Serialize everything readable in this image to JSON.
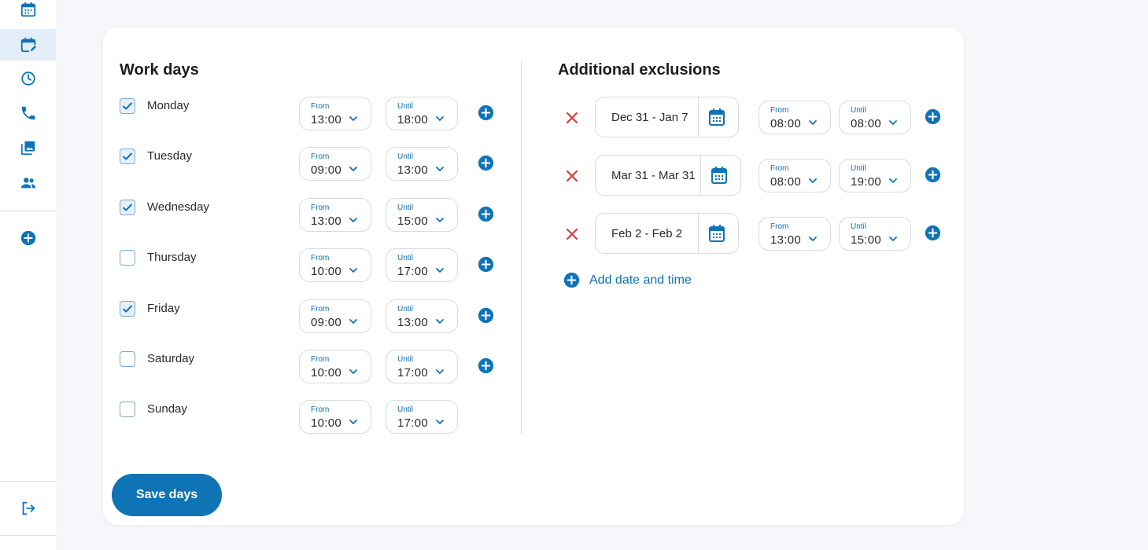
{
  "colors": {
    "accent": "#0f74b6",
    "danger": "#d93b3b",
    "page_bg": "#f5f7fb"
  },
  "sidebar": {
    "items": [
      {
        "icon": "calendar-icon",
        "active": false
      },
      {
        "icon": "calendar-edit-icon",
        "active": true
      },
      {
        "icon": "clock-icon",
        "active": false
      },
      {
        "icon": "phone-icon",
        "active": false
      },
      {
        "icon": "gallery-icon",
        "active": false
      },
      {
        "icon": "users-icon",
        "active": false
      },
      {
        "icon": "add-icon",
        "active": false
      },
      {
        "icon": "logout-icon",
        "active": false
      }
    ]
  },
  "work_days": {
    "title": "Work days",
    "days": [
      {
        "label": "Monday",
        "checked": true,
        "from_label": "From",
        "from": "13:00",
        "until_label": "Until",
        "until": "18:00",
        "has_add": true
      },
      {
        "label": "Tuesday",
        "checked": true,
        "from_label": "From",
        "from": "09:00",
        "until_label": "Until",
        "until": "13:00",
        "has_add": true
      },
      {
        "label": "Wednesday",
        "checked": true,
        "from_label": "From",
        "from": "13:00",
        "until_label": "Until",
        "until": "15:00",
        "has_add": true
      },
      {
        "label": "Thursday",
        "checked": false,
        "from_label": "From",
        "from": "10:00",
        "until_label": "Until",
        "until": "17:00",
        "has_add": true
      },
      {
        "label": "Friday",
        "checked": true,
        "from_label": "From",
        "from": "09:00",
        "until_label": "Until",
        "until": "13:00",
        "has_add": true
      },
      {
        "label": "Saturday",
        "checked": false,
        "from_label": "From",
        "from": "10:00",
        "until_label": "Until",
        "until": "17:00",
        "has_add": true
      },
      {
        "label": "Sunday",
        "checked": false,
        "from_label": "From",
        "from": "10:00",
        "until_label": "Until",
        "until": "17:00",
        "has_add": false
      }
    ]
  },
  "exclusions": {
    "title": "Additional exclusions",
    "items": [
      {
        "date_range": "Dec 31 - Jan 7",
        "from_label": "From",
        "from": "08:00",
        "until_label": "Until",
        "until": "08:00"
      },
      {
        "date_range": "Mar 31 - Mar 31",
        "from_label": "From",
        "from": "08:00",
        "until_label": "Until",
        "until": "19:00"
      },
      {
        "date_range": "Feb 2 - Feb 2",
        "from_label": "From",
        "from": "13:00",
        "until_label": "Until",
        "until": "15:00"
      }
    ],
    "add_label": "Add date and time"
  },
  "save_label": "Save days"
}
